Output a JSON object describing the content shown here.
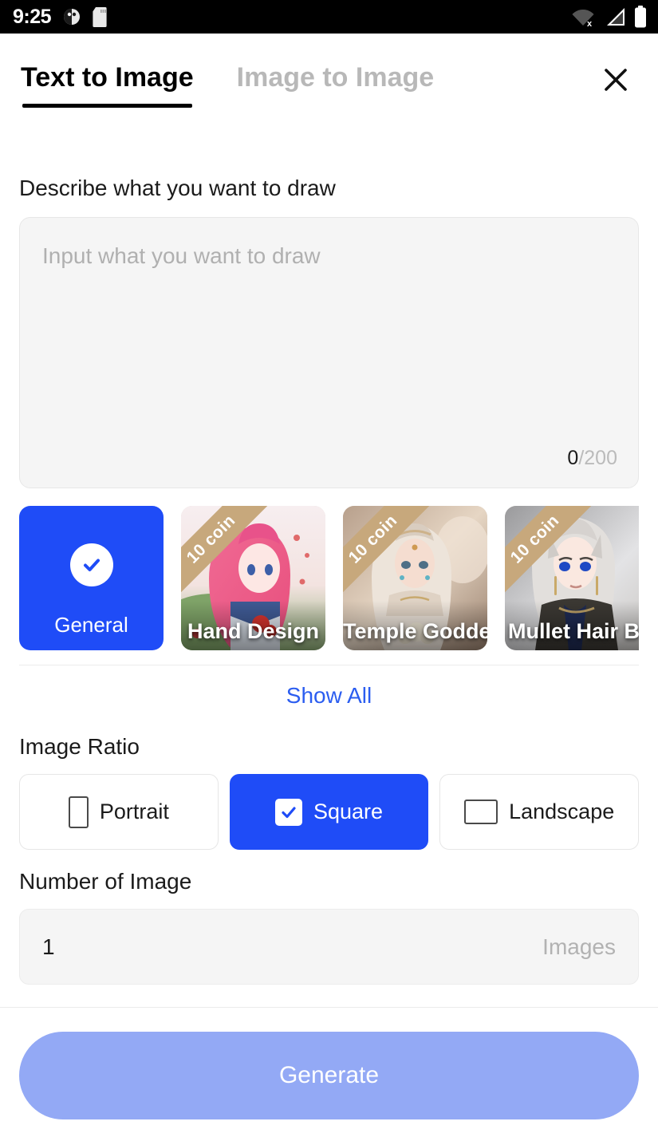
{
  "status_bar": {
    "time": "9:25",
    "left_icons": [
      "alarm-icon",
      "sd-card-icon"
    ],
    "right_icons": [
      "wifi-off-icon",
      "cellular-signal-icon",
      "battery-icon"
    ]
  },
  "header": {
    "tabs": [
      {
        "label": "Text to Image",
        "active": true
      },
      {
        "label": "Image to Image",
        "active": false
      }
    ],
    "close_icon": "close-icon"
  },
  "prompt": {
    "label": "Describe what you want to draw",
    "placeholder": "Input what you want to draw",
    "current_count": "0",
    "max_count": "/200"
  },
  "styles": {
    "cards": [
      {
        "label": "General",
        "selected": true,
        "badge": null
      },
      {
        "label": "Hand Design",
        "selected": false,
        "badge": "10 coin"
      },
      {
        "label": "Temple Goddess",
        "selected": false,
        "badge": "10 coin"
      },
      {
        "label": "Mullet Hair Boy",
        "selected": false,
        "badge": "10 coin"
      }
    ],
    "show_all_label": "Show All"
  },
  "image_ratio": {
    "label": "Image Ratio",
    "options": [
      {
        "label": "Portrait",
        "icon": "portrait-rect-icon",
        "selected": false
      },
      {
        "label": "Square",
        "icon": "checkbox-checked-icon",
        "selected": true
      },
      {
        "label": "Landscape",
        "icon": "landscape-rect-icon",
        "selected": false
      }
    ]
  },
  "number_of_image": {
    "label": "Number of Image",
    "value": "1",
    "suffix": "Images"
  },
  "footer": {
    "generate_label": "Generate"
  },
  "colors": {
    "accent_blue": "#1f4cf7",
    "link_blue": "#2b5df0",
    "disabled_blue": "#93a9f5",
    "ribbon_tan": "#c7a87c",
    "field_bg": "#f5f5f5"
  }
}
